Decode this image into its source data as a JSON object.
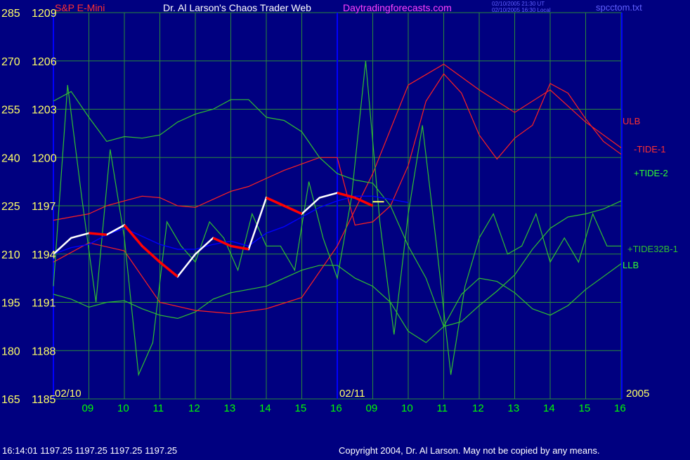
{
  "header": {
    "instrument": "S&P E-Mini",
    "title": "Dr. Al Larson's Chaos Trader Web",
    "website": "Daytradingforecasts.com",
    "timestamp_ut": "02/10/2005 21:30 UT",
    "timestamp_local": "02/10/2005 16:30 Local",
    "file": "spcctom.txt"
  },
  "footer": {
    "quote": "16:14:01  1197.25 1197.25 1197.25 1197.25",
    "copyright": "Copyright 2004, Dr. Al Larson. May not be copied by any means."
  },
  "colors": {
    "background": "#000080",
    "grid": "#2a8a3a",
    "left_axis": "#ffff66",
    "time_labels": "#00ff00",
    "price_bars": "#ffffff",
    "down_bars": "#ff0000",
    "ulb_llb": "#ff2020",
    "tide1": "#ff2020",
    "tide2": "#30c030",
    "tide32b": "#30c030",
    "average": "#0000ff",
    "session_divider": "#0000ff",
    "title": "#ffffff",
    "website": "#ff40ff",
    "instrument": "#ff3030",
    "file": "#6060ff"
  },
  "chart_data": {
    "type": "line",
    "y_left_outer_ticks": [
      "285",
      "270",
      "255",
      "240",
      "225",
      "210",
      "195",
      "180",
      "165"
    ],
    "y_left_inner_ticks": [
      "1209",
      "1206",
      "1203",
      "1200",
      "1197",
      "1194",
      "1191",
      "1188",
      "1185"
    ],
    "y_price_range": [
      1185,
      1209
    ],
    "y_outer_range": [
      165,
      285
    ],
    "x_time_labels": [
      "09",
      "10",
      "11",
      "12",
      "13",
      "14",
      "15",
      "16",
      "09",
      "10",
      "11",
      "12",
      "13",
      "14",
      "15",
      "16"
    ],
    "date_labels": [
      "02/10",
      "02/11"
    ],
    "year_label": "2005",
    "series_labels": [
      "ULB",
      "-TIDE-1",
      "+TIDE-2",
      "+TIDE32B-1",
      "LLB"
    ],
    "last_price": 1197.25,
    "series": [
      {
        "name": "ULB",
        "x": [
          0,
          0.5,
          1,
          1.5,
          2,
          2.5,
          3,
          3.5,
          4,
          4.5,
          5,
          5.5,
          6,
          6.5,
          7,
          7.5,
          8,
          8.5,
          9,
          9.5,
          10,
          10.5,
          11,
          11.5,
          12,
          12.5,
          13,
          13.5,
          14,
          14.5,
          15,
          15.5,
          16
        ],
        "values": [
          1196.1,
          1196.3,
          1196.5,
          1197.0,
          1197.3,
          1197.6,
          1197.5,
          1197.0,
          1196.9,
          1197.4,
          1197.9,
          1198.2,
          1198.7,
          1199.2,
          1199.6,
          1200.0,
          1200.0,
          1195.8,
          1196.0,
          1197.0,
          1199.5,
          1203.5,
          1205.2,
          1204.0,
          1201.4,
          1199.9,
          1201.2,
          1202.0,
          1204.6,
          1204.0,
          1202.4,
          1201.0,
          1200.2
        ]
      },
      {
        "name": "LLB",
        "x": [
          0,
          0.5,
          1,
          1.5,
          2,
          2.5,
          3,
          3.5,
          4,
          4.5,
          5,
          5.5,
          6,
          6.5,
          7,
          7.5,
          8,
          8.5,
          9,
          9.5,
          10,
          10.5,
          11,
          11.5,
          12,
          12.5,
          13,
          13.5,
          14,
          14.5,
          15,
          15.5,
          16
        ],
        "values": [
          1191.5,
          1191.2,
          1190.7,
          1191.0,
          1191.1,
          1190.6,
          1190.2,
          1190.0,
          1190.4,
          1191.2,
          1191.6,
          1191.8,
          1192.0,
          1192.5,
          1193.0,
          1193.3,
          1193.3,
          1192.5,
          1192.0,
          1191.0,
          1189.2,
          1188.5,
          1189.5,
          1191.5,
          1192.5,
          1192.3,
          1191.6,
          1190.6,
          1190.2,
          1190.8,
          1191.8,
          1192.6,
          1193.4
        ]
      },
      {
        "name": "-TIDE-1",
        "x": [
          0,
          1,
          2,
          3,
          4,
          5,
          6,
          7,
          8,
          9,
          10,
          11,
          12,
          13,
          14,
          15,
          16
        ],
        "values": [
          1193.5,
          1194.7,
          1194.2,
          1191.0,
          1190.5,
          1190.3,
          1190.6,
          1191.3,
          1194.5,
          1199.0,
          1204.5,
          1205.8,
          1204.2,
          1202.8,
          1204.2,
          1202.2,
          1200.6
        ]
      },
      {
        "name": "+TIDE-2",
        "x": [
          0,
          0.5,
          1,
          1.5,
          2,
          2.5,
          3,
          3.5,
          4,
          4.5,
          5,
          5.5,
          6,
          6.5,
          7,
          7.5,
          8,
          8.5,
          9,
          9.5,
          10,
          10.5,
          11,
          11.5,
          12,
          12.5,
          13,
          13.5,
          14,
          14.5,
          15,
          15.5,
          16
        ],
        "values": [
          1203.5,
          1204.1,
          1202.5,
          1201.0,
          1201.3,
          1201.2,
          1201.4,
          1202.2,
          1202.7,
          1203.0,
          1203.6,
          1203.6,
          1202.5,
          1202.3,
          1201.6,
          1200.0,
          1199.0,
          1198.6,
          1198.4,
          1197.0,
          1194.5,
          1192.5,
          1189.5,
          1189.8,
          1190.8,
          1191.7,
          1192.7,
          1194.3,
          1195.6,
          1196.3,
          1196.5,
          1196.8,
          1197.3
        ]
      },
      {
        "name": "+TIDE32B-1",
        "x": [
          0,
          0.4,
          0.8,
          1.2,
          1.6,
          2.0,
          2.4,
          2.8,
          3.2,
          3.6,
          4.0,
          4.4,
          4.8,
          5.2,
          5.6,
          6.0,
          6.4,
          6.8,
          7.2,
          7.6,
          8.0,
          8.4,
          8.8,
          9.2,
          9.6,
          10.0,
          10.4,
          10.8,
          11.2,
          11.6,
          12.0,
          12.4,
          12.8,
          13.2,
          13.6,
          14.0,
          14.4,
          14.8,
          15.2,
          15.6,
          16.0
        ],
        "values": [
          1192,
          1204.5,
          1197.5,
          1191.0,
          1200.5,
          1195.0,
          1186.5,
          1188.5,
          1196.0,
          1194.5,
          1193.5,
          1196.0,
          1195.0,
          1193.0,
          1196.5,
          1194.5,
          1194.5,
          1193.0,
          1198.5,
          1195.0,
          1192.5,
          1197.5,
          1206.0,
          1196.0,
          1189.0,
          1196.5,
          1202.0,
          1194.5,
          1186.5,
          1192.0,
          1195.0,
          1196.5,
          1194.0,
          1194.5,
          1196.5,
          1193.5,
          1195.0,
          1193.5,
          1196.5,
          1194.5,
          1194.5
        ]
      },
      {
        "name": "average",
        "x": [
          0,
          0.5,
          1,
          1.5,
          2,
          2.5,
          3,
          3.5,
          4,
          4.5,
          5,
          5.5,
          6,
          6.5,
          7,
          7.5,
          8,
          8.5,
          9,
          9.5,
          10
        ],
        "values": [
          1194.0,
          1194.4,
          1194.6,
          1195.2,
          1195.6,
          1195.1,
          1194.6,
          1194.3,
          1194.3,
          1194.6,
          1194.8,
          1194.5,
          1195.3,
          1195.7,
          1196.3,
          1196.9,
          1197.3,
          1197.6,
          1197.6,
          1197.4,
          1197.2
        ]
      },
      {
        "name": "price",
        "x": [
          0,
          0.5,
          1,
          1.5,
          2,
          2.5,
          3,
          3.5,
          4,
          4.5,
          5,
          5.5,
          6,
          6.5,
          7,
          7.5,
          8,
          8.5,
          9
        ],
        "values": [
          1194.0,
          1195.0,
          1195.3,
          1195.2,
          1195.8,
          1194.5,
          1193.5,
          1192.6,
          1194.0,
          1195.0,
          1194.5,
          1194.3,
          1197.5,
          1197.0,
          1196.5,
          1197.5,
          1197.8,
          1197.5,
          1197.0
        ]
      }
    ]
  }
}
